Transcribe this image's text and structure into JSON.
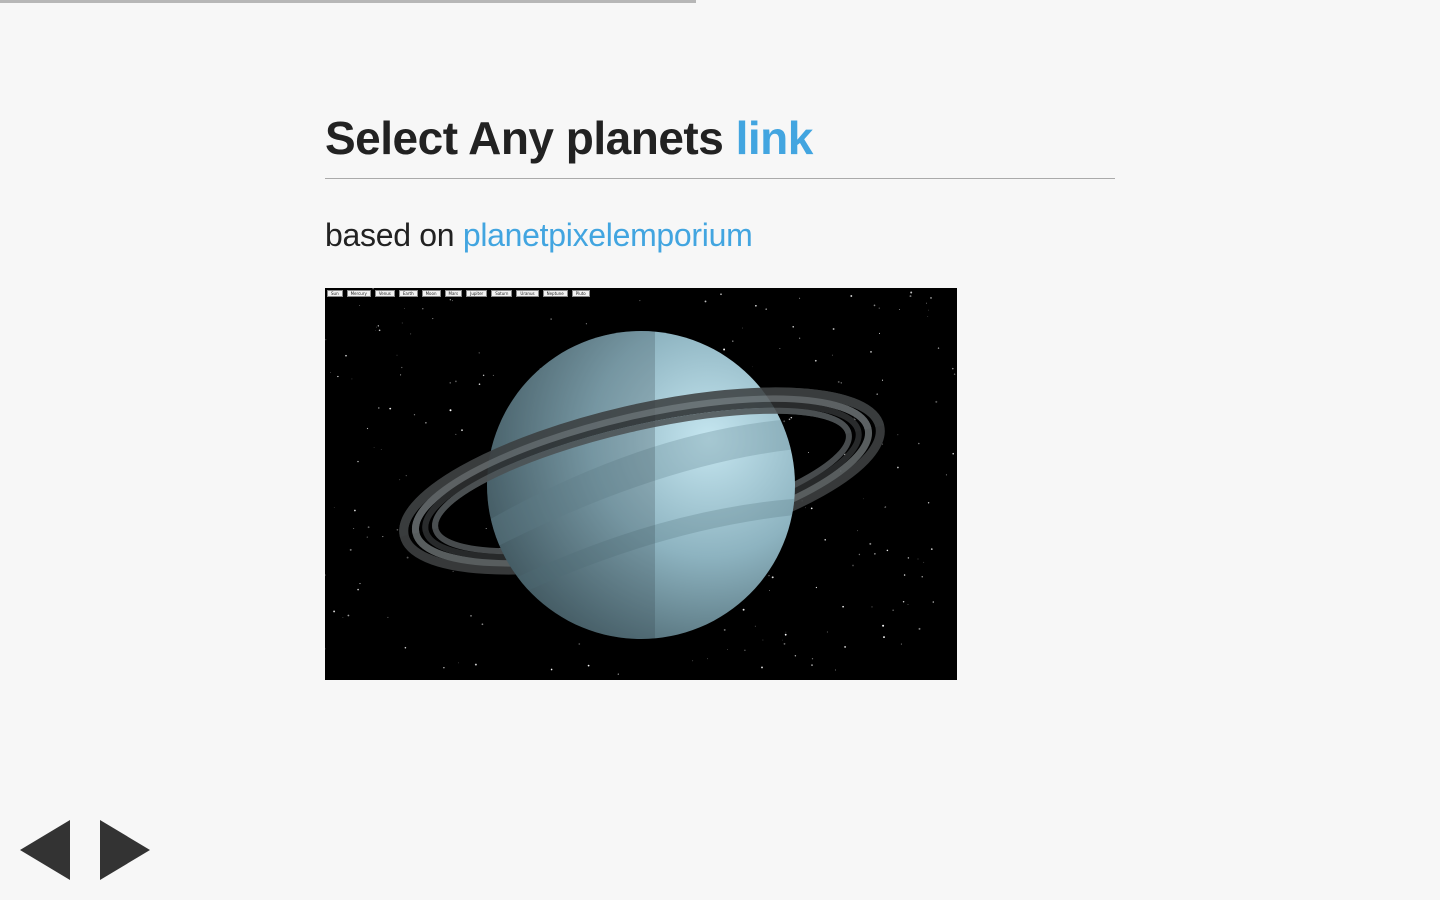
{
  "progress": {
    "fraction": 0.483
  },
  "slide": {
    "title_prefix": "Select Any planets ",
    "title_link": "link",
    "subtitle_prefix": "based on ",
    "subtitle_link": "planetpixelemporium"
  },
  "demo": {
    "planet_buttons": [
      "Sun",
      "Mercury",
      "Venus",
      "Earth",
      "Moon",
      "Mars",
      "Jupiter",
      "Saturn",
      "Uranus",
      "Neptune",
      "Pluto"
    ]
  },
  "nav": {
    "prev_icon": "triangle-left-icon",
    "next_icon": "triangle-right-icon"
  },
  "colors": {
    "accent": "#42a5e0",
    "background": "#f7f7f7",
    "arrow": "#333333"
  }
}
